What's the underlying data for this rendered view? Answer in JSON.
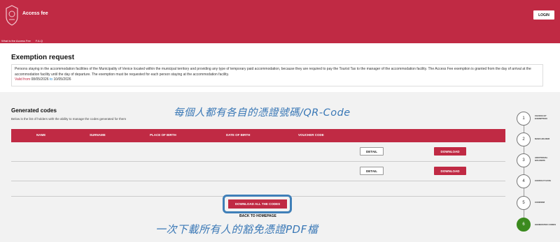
{
  "header": {
    "brand": "Access fee",
    "login_label": "LOGIN",
    "nav": [
      "What is the Access Fee",
      "F.A.Q"
    ]
  },
  "exemption": {
    "title": "Exemption request",
    "text": "Persons staying in the accommodation facilities of the Municipality of Venice located within the municipal territory and providing any type of temporary paid accommodation, because they are required to pay the Tourist Tax to the manager of the accommodation facility. The Access Fee exemption is granted from the day of arrival at the accommodation facility until the day of departure. The exemption must be requested for each person staying at the accommodation facility.",
    "valid_label": "Valid from",
    "date_from": "08/05/2026",
    "to_label": "to",
    "date_to": "10/05/2026"
  },
  "codes": {
    "title": "Generated codes",
    "subtitle": "Below is the list of holders with the ability to manage the codes generated for them",
    "columns": [
      "NAME",
      "SURNAME",
      "PLACE OF BIRTH",
      "DATE OF BIRTH",
      "VOUCHER CODE"
    ],
    "rows": [
      {
        "detail": "DETAIL",
        "download": "DOWNLOAD"
      },
      {
        "detail": "DETAIL",
        "download": "DOWNLOAD"
      }
    ],
    "download_all": "DOWNLOAD ALL THE CODES",
    "back": "BACK TO HOMEPAGE"
  },
  "annotations": {
    "note1": "每個人都有各自的憑證號碼/QR-Code",
    "note2": "一次下載所有人的豁免憑證PDF檔"
  },
  "stepper": [
    {
      "num": "1",
      "label": "CHOICE BY EXEMPTION"
    },
    {
      "num": "2",
      "label": "MAIN HOLDER"
    },
    {
      "num": "3",
      "label": "ADDITIONAL HOLDERS"
    },
    {
      "num": "4",
      "label": "CONTACT DATA"
    },
    {
      "num": "5",
      "label": "CONFIRM"
    },
    {
      "num": "6",
      "label": "GENERATED CODES"
    }
  ],
  "colors": {
    "brand": "#c02a44",
    "annotation": "#3a78b6",
    "step_active": "#3b8a1e"
  }
}
